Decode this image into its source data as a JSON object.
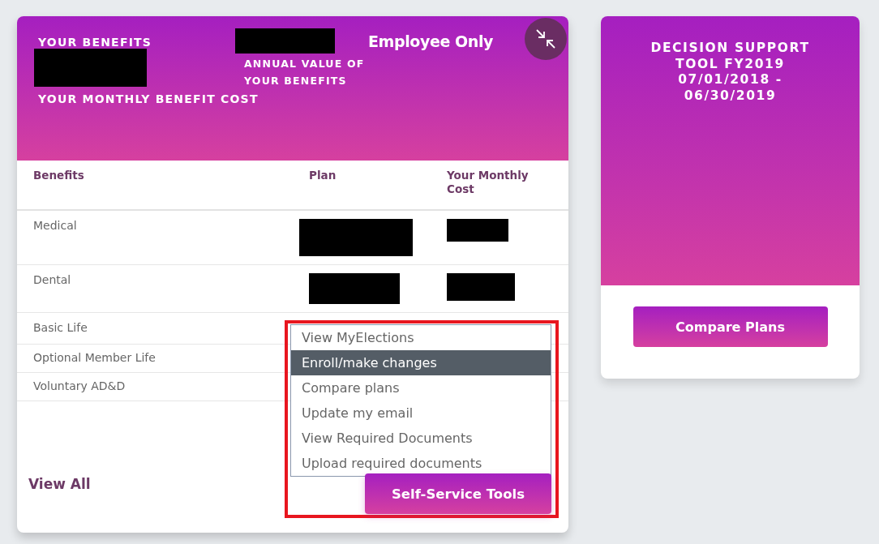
{
  "benefits_card": {
    "title": "YOUR BENEFITS",
    "monthly_cost_redacted": true,
    "monthly_cost_label": "YOUR MONTHLY BENEFIT COST",
    "annual_value_redacted": true,
    "annual_value_label": "ANNUAL VALUE OF YOUR BENEFITS",
    "coverage": "Employee Only",
    "columns": [
      "Benefits",
      "Plan",
      "Your Monthly Cost"
    ],
    "rows": [
      {
        "benefit": "Medical",
        "plan_redacted": true,
        "cost_redacted": true
      },
      {
        "benefit": "Dental",
        "plan_redacted": true,
        "cost_redacted": true
      },
      {
        "benefit": "Basic Life",
        "plan_redacted": false,
        "cost_redacted": false
      },
      {
        "benefit": "Optional Member Life",
        "plan_redacted": false,
        "cost_redacted": false
      },
      {
        "benefit": "Voluntary AD&D",
        "plan_redacted": false,
        "cost_redacted": false
      }
    ],
    "view_all": "View All",
    "self_service": {
      "highlighted": true,
      "button": "Self-Service Tools",
      "menu": [
        {
          "label": "View MyElections",
          "selected": false
        },
        {
          "label": "Enroll/make changes",
          "selected": true
        },
        {
          "label": "Compare plans",
          "selected": false
        },
        {
          "label": "Update my email",
          "selected": false
        },
        {
          "label": "View Required Documents",
          "selected": false
        },
        {
          "label": "Upload required documents",
          "selected": false
        }
      ]
    }
  },
  "decision_card": {
    "title": "DECISION SUPPORT TOOL FY2019 07/01/2018 - 06/30/2019",
    "button": "Compare Plans"
  }
}
